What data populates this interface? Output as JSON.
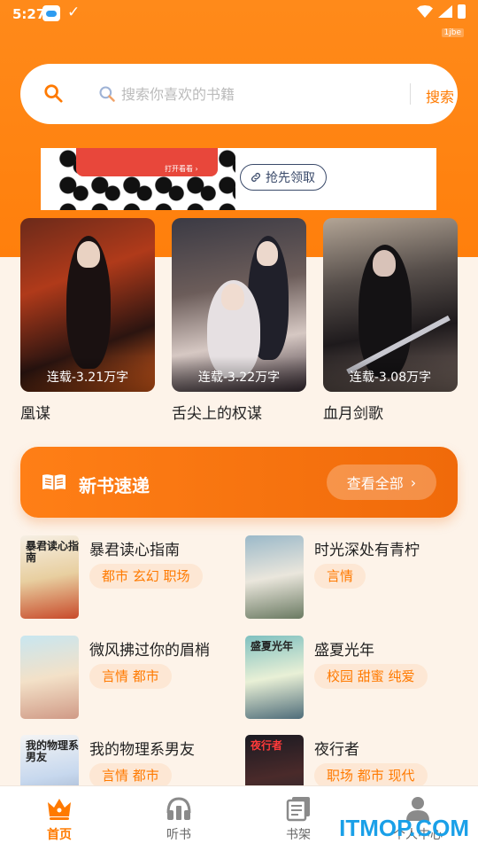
{
  "status_bar": {
    "time": "5:27",
    "tag": "1jbe"
  },
  "search": {
    "placeholder": "搜索你喜欢的书籍",
    "button_label": "搜索"
  },
  "ad": {
    "cta_label": "抢先领取",
    "red_text": "打开看看 ›"
  },
  "featured": [
    {
      "title": "凰谋",
      "badge": "连载-3.21万字"
    },
    {
      "title": "舌尖上的权谋",
      "badge": "连载-3.22万字"
    },
    {
      "title": "血月剑歌",
      "badge": "连载-3.08万字"
    }
  ],
  "new_books": {
    "title": "新书速递",
    "view_all": "查看全部"
  },
  "books": [
    {
      "name": "暴君读心指南",
      "tags": "都市 玄幻 职场",
      "cover_text": "暴君读心指南"
    },
    {
      "name": "时光深处有青柠",
      "tags": "言情",
      "cover_text": ""
    },
    {
      "name": "微风拂过你的眉梢",
      "tags": "言情 都市",
      "cover_text": ""
    },
    {
      "name": "盛夏光年",
      "tags": "校园 甜蜜 纯爱",
      "cover_text": "盛夏光年"
    },
    {
      "name": "我的物理系男友",
      "tags": "言情 都市",
      "cover_text": "我的物理系男友"
    },
    {
      "name": "夜行者",
      "tags": "职场 都市 现代",
      "cover_text": "夜行者"
    }
  ],
  "nav": [
    {
      "label": "首页",
      "active": true
    },
    {
      "label": "听书",
      "active": false
    },
    {
      "label": "书架",
      "active": false
    },
    {
      "label": "个人中心",
      "active": false
    }
  ],
  "watermark": "ITMOP.COM",
  "colors": {
    "accent": "#ff7a00",
    "header_bg": "#ff8a1a",
    "tag_bg": "#fde7d4",
    "page_bg": "#fdf3e9"
  }
}
